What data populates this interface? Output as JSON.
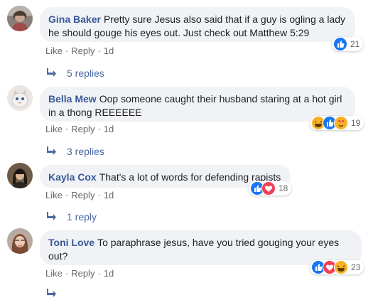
{
  "comments": [
    {
      "name": "Gina Baker",
      "text": "Pretty sure Jesus also said that if a guy is ogling a lady he should gouge his eyes out. Just check out Matthew 5:29",
      "actions": {
        "like": "Like",
        "reply": "Reply",
        "time": "1d"
      },
      "reaction_count": "21",
      "reactions": [
        "like-icon"
      ],
      "replies_label": "5 replies"
    },
    {
      "name": "Bella Mew",
      "text": "Oop someone caught their husband staring at a hot girl in a thong REEEEEE",
      "actions": {
        "like": "Like",
        "reply": "Reply",
        "time": "1d"
      },
      "reaction_count": "19",
      "reactions": [
        "haha-icon",
        "like-icon",
        "love-face-icon"
      ],
      "replies_label": "3 replies"
    },
    {
      "name": "Kayla Cox",
      "text": "That's a lot of words for defending rapists",
      "actions": {
        "like": "Like",
        "reply": "Reply",
        "time": "1d"
      },
      "reaction_count": "18",
      "reactions": [
        "like-icon",
        "love-icon"
      ],
      "replies_label": "1 reply"
    },
    {
      "name": "Toni Love",
      "text": "To paraphrase jesus, have you tried gouging your eyes out?",
      "actions": {
        "like": "Like",
        "reply": "Reply",
        "time": "1d"
      },
      "reaction_count": "23",
      "reactions": [
        "like-icon",
        "love-icon",
        "haha-icon"
      ],
      "replies_label": ""
    }
  ],
  "colors": {
    "name": "#385898",
    "bubble": "#f0f2f5",
    "link": "#4b6aa6",
    "like": "#1877f2",
    "love": "#f33e58",
    "haha": "#f7b125"
  }
}
